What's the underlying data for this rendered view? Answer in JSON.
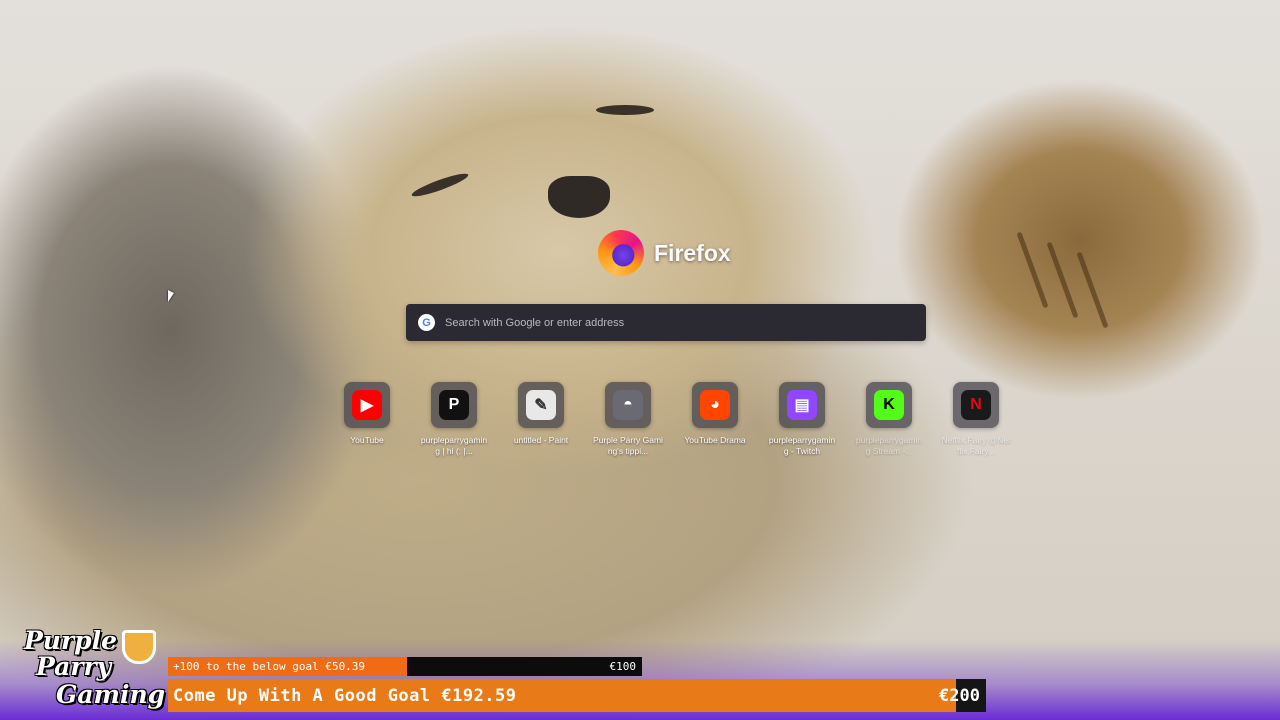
{
  "browser": {
    "name": "Firefox",
    "search_placeholder": "Search with Google or enter address",
    "search_engine_icon": "google-g-icon",
    "cursor_icon": "arrow-cursor"
  },
  "top_sites": [
    {
      "label": "YouTube",
      "icon": "youtube-icon",
      "color": "#ff0000",
      "glyph": "▶"
    },
    {
      "label": "purpleparrygaming | hi (: |...",
      "icon": "linktree-icon",
      "color": "#111111",
      "glyph": "P"
    },
    {
      "label": "untitled - Paint",
      "icon": "paint-icon",
      "color": "#e8e8e8",
      "glyph": "✎"
    },
    {
      "label": "Purple Parry Gaming's tippi...",
      "icon": "tipping-icon",
      "color": "#6a6a74",
      "glyph": "◓"
    },
    {
      "label": "YouTube Drama",
      "icon": "reddit-icon",
      "color": "#ff4500",
      "glyph": "◕"
    },
    {
      "label": "purpleparrygaming - Twitch",
      "icon": "twitch-icon",
      "color": "#9146ff",
      "glyph": "▤"
    },
    {
      "label": "purpleparrygaming Stream -...",
      "icon": "kick-icon",
      "color": "#53fc18",
      "glyph": "K"
    },
    {
      "label": "Netflix.Fairy @Netflix.Fairy...",
      "icon": "netflix-icon",
      "color": "#1a1a1a",
      "glyph": "N"
    }
  ],
  "stream_overlay": {
    "logo_lines": [
      "Purple",
      "Parry",
      "Gaming"
    ],
    "sub_goal": {
      "text": "+100 to the below goal €50.39",
      "target": "€100",
      "progress": 0.504
    },
    "main_goal": {
      "text": "Come Up With A Good Goal €192.59",
      "target": "€200",
      "progress": 0.963
    },
    "accent_color": "#ef6c14",
    "bg_color": "#6a2bd6"
  }
}
